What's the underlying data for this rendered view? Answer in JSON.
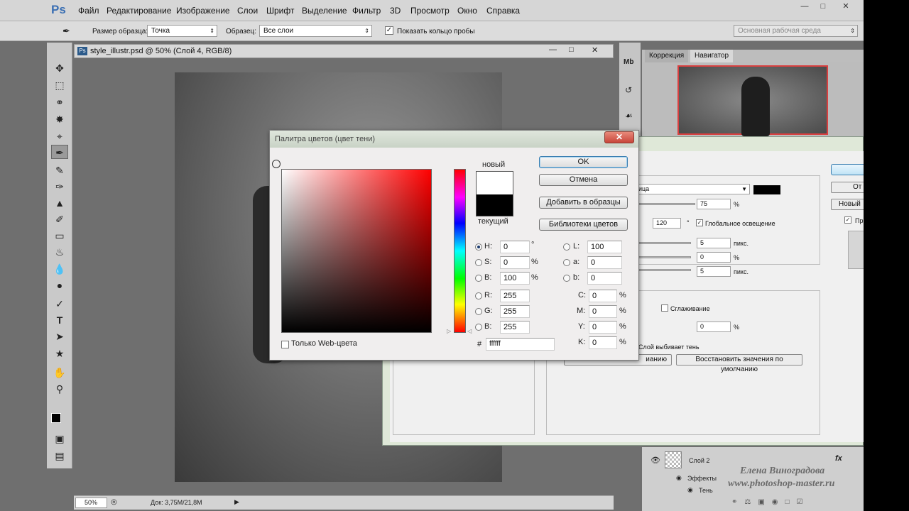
{
  "menubar": {
    "logo": "Ps",
    "items": [
      "Файл",
      "Редактирование",
      "Изображение",
      "Слои",
      "Шрифт",
      "Выделение",
      "Фильтр",
      "3D",
      "Просмотр",
      "Окно",
      "Справка"
    ]
  },
  "options": {
    "sample_size_label": "Размер образца:",
    "sample_size_value": "Точка",
    "sample_label": "Образец:",
    "sample_value": "Все слои",
    "show_ring_label": "Показать кольцо пробы",
    "workspace": "Основная рабочая среда"
  },
  "document": {
    "tab_title": "style_illustr.psd @ 50% (Слой 4, RGB/8)",
    "zoom": "50%",
    "doc_size": "Док: 3,75M/21,8M"
  },
  "panels": {
    "tab_correction": "Коррекция",
    "tab_navigator": "Навигатор"
  },
  "layers": {
    "layer_name": "Слой 2",
    "effects_label": "Эффекты",
    "shadow_label": "Тень",
    "fx": "fx"
  },
  "layer_style": {
    "ok_label": "",
    "cancel_label": "От",
    "new_label": "Новый",
    "preview_label": "Пр",
    "blend_mode": "ица",
    "opacity": "75",
    "opacity_unit": "%",
    "angle": "120",
    "angle_unit": "°",
    "global_light_label": "Глобальное освещение",
    "distance": "5",
    "distance_unit": "пикс.",
    "spread": "0",
    "spread_unit": "%",
    "size": "5",
    "size_unit": "пикс.",
    "antialias_label": "Сглаживание",
    "noise": "0",
    "noise_unit": "%",
    "knockout_label": "Слой выбивает тень",
    "make_default_label": "ианию",
    "reset_default_label": "Восстановить значения по умолчанию"
  },
  "color_picker": {
    "title": "Палитра цветов (цвет тени)",
    "new_label": "новый",
    "current_label": "текущий",
    "ok_label": "OK",
    "cancel_label": "Отмена",
    "add_swatch_label": "Добавить в образцы",
    "libraries_label": "Библиотеки цветов",
    "web_only_label": "Только Web-цвета",
    "new_color": "#ffffff",
    "current_color": "#000000",
    "hsb": [
      {
        "key": "H:",
        "value": "0",
        "unit": "°"
      },
      {
        "key": "S:",
        "value": "0",
        "unit": "%"
      },
      {
        "key": "B:",
        "value": "100",
        "unit": "%"
      }
    ],
    "rgb": [
      {
        "key": "R:",
        "value": "255"
      },
      {
        "key": "G:",
        "value": "255"
      },
      {
        "key": "B:",
        "value": "255"
      }
    ],
    "lab": [
      {
        "key": "L:",
        "value": "100"
      },
      {
        "key": "a:",
        "value": "0"
      },
      {
        "key": "b:",
        "value": "0"
      }
    ],
    "cmyk": [
      {
        "key": "C:",
        "value": "0",
        "unit": "%"
      },
      {
        "key": "M:",
        "value": "0",
        "unit": "%"
      },
      {
        "key": "Y:",
        "value": "0",
        "unit": "%"
      },
      {
        "key": "K:",
        "value": "0",
        "unit": "%"
      }
    ],
    "hex_label": "#",
    "hex_value": "ffffff"
  },
  "watermark": {
    "author": "Елена Виноградова",
    "site": "www.photoshop-master.ru"
  }
}
